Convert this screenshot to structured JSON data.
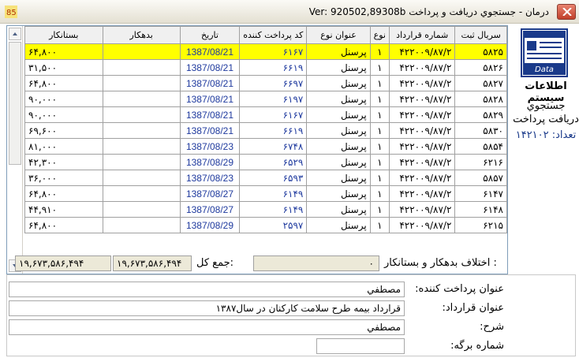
{
  "window": {
    "title": "Ver: 920502,89308b   درمان - جستجوي دريافت و پرداخت"
  },
  "grid": {
    "columns": {
      "serial": "سريال ثبت",
      "contract": "شماره قرارداد",
      "type": "نوع",
      "title_type": "عنوان نوع",
      "payer_code": "کد پرداخت کننده",
      "date": "تاريخ",
      "debtor": "بدهكار",
      "creditor": "بستانكار"
    },
    "rows": [
      {
        "serial": "۵۸۲۵",
        "contract": "۴۲۲۰۰۹/۸۷/۲",
        "type": "۱",
        "title_type": "پرسنل",
        "payer_code": "۶۱۶۷",
        "date": "1387/08/21",
        "debtor": "",
        "creditor": "۶۴,۸۰۰"
      },
      {
        "serial": "۵۸۲۶",
        "contract": "۴۲۲۰۰۹/۸۷/۲",
        "type": "۱",
        "title_type": "پرسنل",
        "payer_code": "۶۶۱۹",
        "date": "1387/08/21",
        "debtor": "",
        "creditor": "۳۱,۵۰۰"
      },
      {
        "serial": "۵۸۲۷",
        "contract": "۴۲۲۰۰۹/۸۷/۲",
        "type": "۱",
        "title_type": "پرسنل",
        "payer_code": "۶۶۹۷",
        "date": "1387/08/21",
        "debtor": "",
        "creditor": "۶۴,۸۰۰"
      },
      {
        "serial": "۵۸۲۸",
        "contract": "۴۲۲۰۰۹/۸۷/۲",
        "type": "۱",
        "title_type": "پرسنل",
        "payer_code": "۶۱۹۷",
        "date": "1387/08/21",
        "debtor": "",
        "creditor": "۹۰,۰۰۰"
      },
      {
        "serial": "۵۸۲۹",
        "contract": "۴۲۲۰۰۹/۸۷/۲",
        "type": "۱",
        "title_type": "پرسنل",
        "payer_code": "۶۱۶۷",
        "date": "1387/08/21",
        "debtor": "",
        "creditor": "۹۰,۰۰۰"
      },
      {
        "serial": "۵۸۳۰",
        "contract": "۴۲۲۰۰۹/۸۷/۲",
        "type": "۱",
        "title_type": "پرسنل",
        "payer_code": "۶۶۱۹",
        "date": "1387/08/21",
        "debtor": "",
        "creditor": "۶۹,۶۰۰"
      },
      {
        "serial": "۵۸۵۴",
        "contract": "۴۲۲۰۰۹/۸۷/۲",
        "type": "۱",
        "title_type": "پرسنل",
        "payer_code": "۶۷۴۸",
        "date": "1387/08/23",
        "debtor": "",
        "creditor": "۸۱,۰۰۰"
      },
      {
        "serial": "۶۲۱۶",
        "contract": "۴۲۲۰۰۹/۸۷/۲",
        "type": "۱",
        "title_type": "پرسنل",
        "payer_code": "۶۵۲۹",
        "date": "1387/08/29",
        "debtor": "",
        "creditor": "۴۲,۳۰۰"
      },
      {
        "serial": "۵۸۵۷",
        "contract": "۴۲۲۰۰۹/۸۷/۲",
        "type": "۱",
        "title_type": "پرسنل",
        "payer_code": "۶۵۹۳",
        "date": "1387/08/23",
        "debtor": "",
        "creditor": "۳۶,۰۰۰"
      },
      {
        "serial": "۶۱۴۷",
        "contract": "۴۲۲۰۰۹/۸۷/۲",
        "type": "۱",
        "title_type": "پرسنل",
        "payer_code": "۶۱۴۹",
        "date": "1387/08/27",
        "debtor": "",
        "creditor": "۶۴,۸۰۰"
      },
      {
        "serial": "۶۱۴۸",
        "contract": "۴۲۲۰۰۹/۸۷/۲",
        "type": "۱",
        "title_type": "پرسنل",
        "payer_code": "۶۱۴۹",
        "date": "1387/08/27",
        "debtor": "",
        "creditor": "۴۴,۹۱۰"
      },
      {
        "serial": "۶۲۱۵",
        "contract": "۴۲۲۰۰۹/۸۷/۲",
        "type": "۱",
        "title_type": "پرسنل",
        "payer_code": "۲۵۹۷",
        "date": "1387/08/29",
        "debtor": "",
        "creditor": "۶۴,۸۰۰"
      }
    ]
  },
  "footer": {
    "diff_label": "اختلاف بدهكار و بستانكار :",
    "diff_value": "۰",
    "total_label": "جمع كل:",
    "total_debtor": "۱۹,۶۷۳,۵۸۶,۴۹۴",
    "total_creditor": "۱۹,۶۷۳,۵۸۶,۴۹۴"
  },
  "side_panel": {
    "title": "اطلاعات سيستم",
    "subtitle_1": "جستجوي",
    "subtitle_2": "دريافت پرداخت",
    "count": "تعداد: ۱۴۲۱۰۲",
    "icon_label": "Data"
  },
  "details": {
    "payer_title_label": "عنوان پرداخت كننده:",
    "payer_title_value": "مصطفي",
    "contract_title_label": "عنوان قرارداد:",
    "contract_title_value": "قرارداد بيمه طرح سلامت كاركنان در سال۱۳۸۷",
    "description_label": "شرح:",
    "description_value": "مصطفي",
    "sheet_number_label": "شماره برگه:",
    "sheet_number_value": ""
  }
}
